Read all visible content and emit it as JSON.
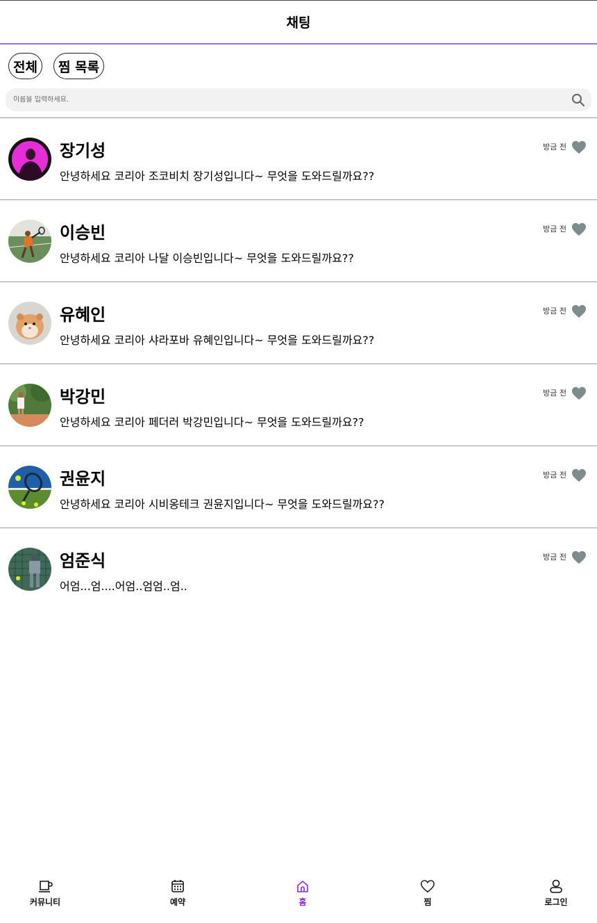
{
  "header": {
    "title": "채팅"
  },
  "filters": [
    {
      "label": "전체"
    },
    {
      "label": "찜 목록"
    }
  ],
  "search": {
    "placeholder": "이름을 입력하세요.",
    "icon": "search-icon"
  },
  "chats": [
    {
      "name": "장기성",
      "message": "안녕하세요 코리아 조코비치 장기성입니다~ 무엇을 도와드릴까요??",
      "time": "방금 전",
      "avatar": "person-magenta"
    },
    {
      "name": "이승빈",
      "message": "안녕하세요 코리아 나달 이승빈입니다~ 무엇을 도와드릴까요??",
      "time": "방금 전",
      "avatar": "tennis-player-court"
    },
    {
      "name": "유혜인",
      "message": "안녕하세요 코리아 샤라포바 유혜인입니다~ 무엇을 도와드릴까요??",
      "time": "방금 전",
      "avatar": "hamster"
    },
    {
      "name": "박강민",
      "message": "안녕하세요 코리아 페더러 박강민입니다~ 무엇을 도와드릴까요??",
      "time": "방금 전",
      "avatar": "tennis-player-trees"
    },
    {
      "name": "권윤지",
      "message": "안녕하세요 코리아 시비옹테크 권윤지입니다~ 무엇을 도와드릴까요??",
      "time": "방금 전",
      "avatar": "tennis-racket"
    },
    {
      "name": "엄준식",
      "message": "어엄...엄....어엄..엄엄..엄..",
      "time": "방금 전",
      "avatar": "player-at-fence"
    }
  ],
  "nav": [
    {
      "label": "커뮤니티",
      "icon": "cup-icon",
      "active": false
    },
    {
      "label": "예약",
      "icon": "calendar-icon",
      "active": false
    },
    {
      "label": "홈",
      "icon": "home-icon",
      "active": true
    },
    {
      "label": "찜",
      "icon": "heart-icon",
      "active": false
    },
    {
      "label": "로그인",
      "icon": "user-icon",
      "active": false
    }
  ],
  "colors": {
    "accent": "#8a2be2",
    "header_border": "#9b6bdc",
    "heart": "#7f8c8d",
    "search_bg": "#f2f2f2"
  }
}
